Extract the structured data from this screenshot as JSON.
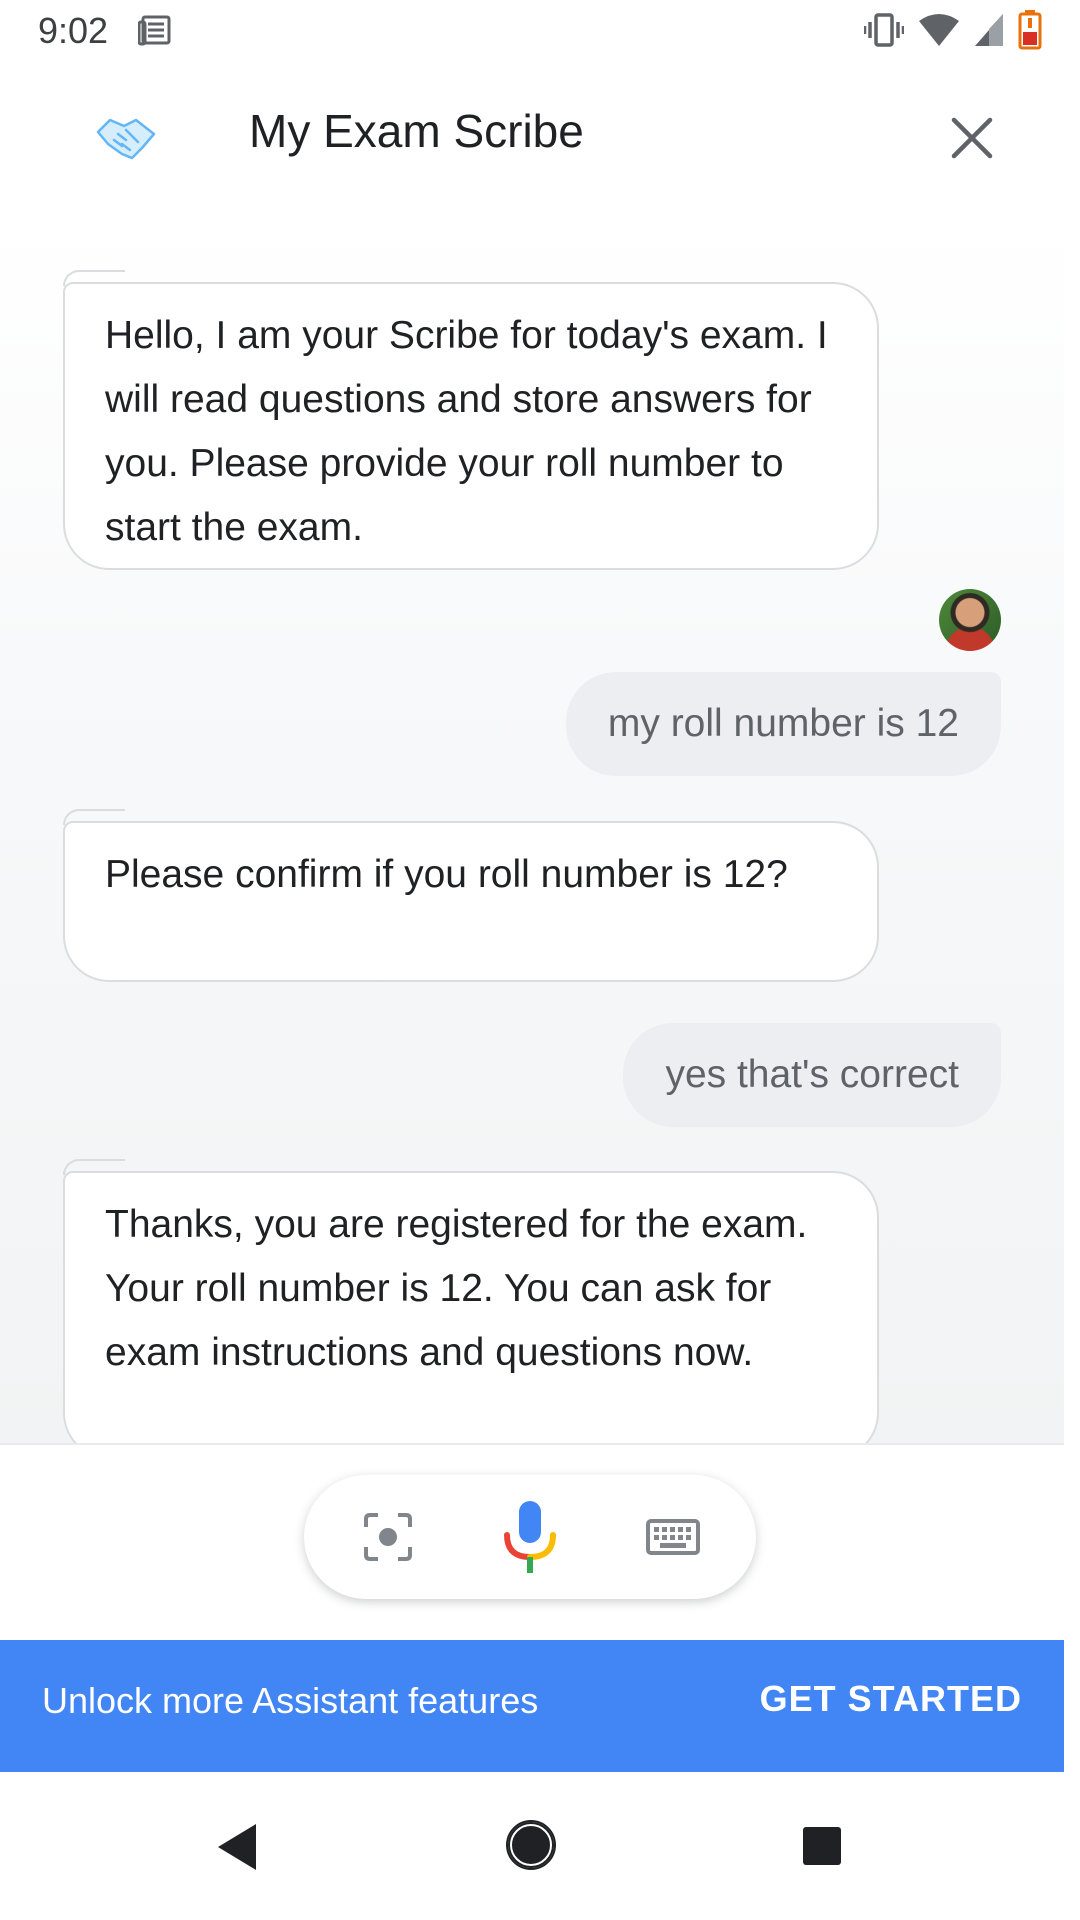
{
  "status_bar": {
    "time": "9:02"
  },
  "header": {
    "title": "My Exam Scribe"
  },
  "messages": [
    {
      "from": "bot",
      "text": "Hello, I am your Scribe for today's exam. I will read questions and store answers for you. Please provide your roll number to start the exam."
    },
    {
      "from": "user",
      "text": "my roll number is 12"
    },
    {
      "from": "bot",
      "text": "Please confirm if you roll number is 12?"
    },
    {
      "from": "user",
      "text": "yes that's correct"
    },
    {
      "from": "bot",
      "text": "Thanks, you are registered for the exam. Your roll number is 12. You can ask for exam instructions and questions now."
    }
  ],
  "promo": {
    "text": "Unlock more Assistant features",
    "button": "GET STARTED"
  },
  "colors": {
    "accent": "#4285f4",
    "mic_blue": "#4285f4",
    "mic_red": "#ea4335",
    "mic_yellow": "#fbbc04",
    "mic_green": "#34a853"
  }
}
